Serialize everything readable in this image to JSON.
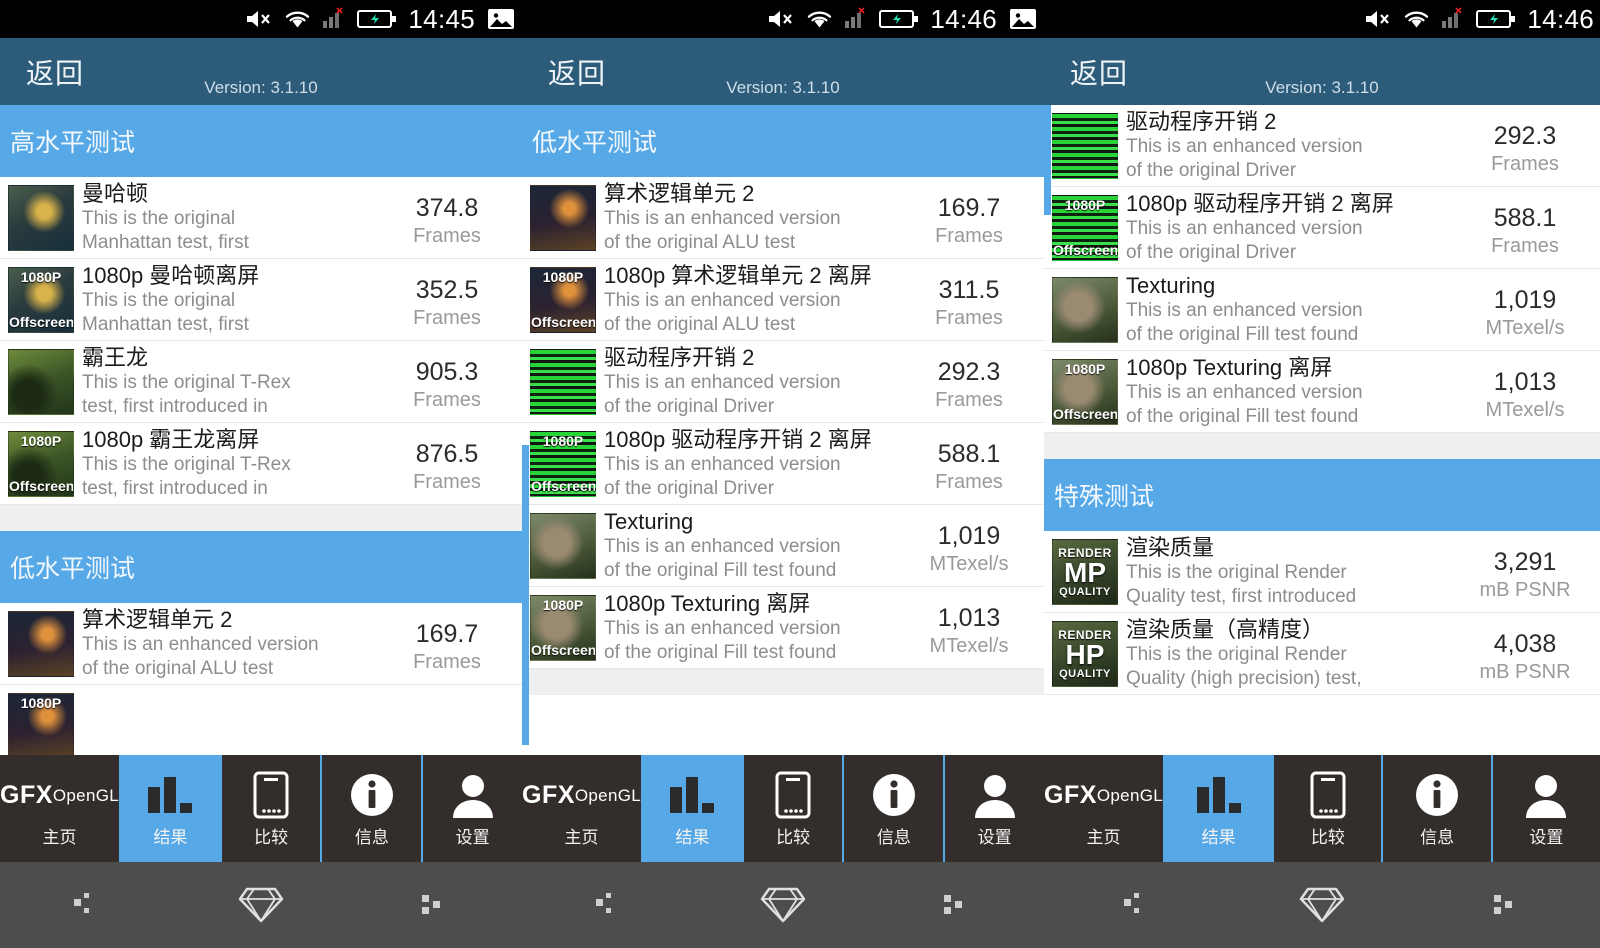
{
  "status_bar": {
    "panels": [
      {
        "time": "14:45",
        "icons": [
          "mute-icon",
          "wifi-icon",
          "signal-icon",
          "battery-charging-icon",
          "screenshot-icon"
        ]
      },
      {
        "time": "14:46",
        "icons": [
          "mute-icon",
          "wifi-icon",
          "signal-icon",
          "battery-charging-icon",
          "screenshot-icon"
        ]
      },
      {
        "time": "14:46",
        "icons": [
          "mute-icon",
          "wifi-icon",
          "signal-icon",
          "battery-charging-icon"
        ]
      }
    ]
  },
  "app_bar": {
    "back_label": "返回",
    "version_label": "Version: 3.1.10"
  },
  "sections": {
    "high_level": "高水平测试",
    "low_level": "低水平测试",
    "special": "特殊测试"
  },
  "units": {
    "frames": "Frames",
    "mtexel": "MTexel/s",
    "psnr": "mB PSNR"
  },
  "descriptions": {
    "manhattan": [
      "This is the original",
      "Manhattan test, first"
    ],
    "trex": [
      "This is the original T-Rex",
      "test, first introduced in"
    ],
    "alu": [
      "This is an enhanced version",
      "of the original ALU test"
    ],
    "driver": [
      "This is an enhanced version",
      "of the original Driver"
    ],
    "fill": [
      "This is an enhanced version",
      "of the original Fill test found"
    ],
    "render_mp": [
      "This is the original Render",
      "Quality test, first introduced"
    ],
    "render_hp": [
      "This is the original Render",
      "Quality (high precision) test,"
    ]
  },
  "panel1": {
    "section_a": "高水平测试",
    "rows_a": [
      {
        "title": "曼哈顿",
        "d1": "This is the original",
        "d2": "Manhattan test, first",
        "num": "374.8",
        "unit": "Frames",
        "thumb": "th-manhattan",
        "badge_top": "",
        "badge_bot": ""
      },
      {
        "title": "1080p 曼哈顿离屏",
        "d1": "This is the original",
        "d2": "Manhattan test, first",
        "num": "352.5",
        "unit": "Frames",
        "thumb": "th-manhattan",
        "badge_top": "1080P",
        "badge_bot": "Offscreen"
      },
      {
        "title": "霸王龙",
        "d1": "This is the original T-Rex",
        "d2": "test, first introduced in",
        "num": "905.3",
        "unit": "Frames",
        "thumb": "th-trex",
        "badge_top": "",
        "badge_bot": ""
      },
      {
        "title": "1080p 霸王龙离屏",
        "d1": "This is the original T-Rex",
        "d2": "test, first introduced in",
        "num": "876.5",
        "unit": "Frames",
        "thumb": "th-trex",
        "badge_top": "1080P",
        "badge_bot": "Offscreen"
      }
    ],
    "section_b": "低水平测试",
    "rows_b": [
      {
        "title": "算术逻辑单元 2",
        "d1": "This is an enhanced version",
        "d2": "of the original ALU test",
        "num": "169.7",
        "unit": "Frames",
        "thumb": "th-alu",
        "badge_top": "",
        "badge_bot": ""
      }
    ]
  },
  "panel2": {
    "section_a": "低水平测试",
    "rows_a": [
      {
        "title": "算术逻辑单元 2",
        "d1": "This is an enhanced version",
        "d2": "of the original ALU test",
        "num": "169.7",
        "unit": "Frames",
        "thumb": "th-alu",
        "badge_top": "",
        "badge_bot": ""
      },
      {
        "title": "1080p 算术逻辑单元 2 离屏",
        "d1": "This is an enhanced version",
        "d2": "of the original ALU test",
        "num": "311.5",
        "unit": "Frames",
        "thumb": "th-alu",
        "badge_top": "1080P",
        "badge_bot": "Offscreen"
      },
      {
        "title": "驱动程序开销 2",
        "d1": "This is an enhanced version",
        "d2": "of the original Driver",
        "num": "292.3",
        "unit": "Frames",
        "thumb": "th-driver",
        "badge_top": "",
        "badge_bot": ""
      },
      {
        "title": "1080p 驱动程序开销 2 离屏",
        "d1": "This is an enhanced version",
        "d2": "of the original Driver",
        "num": "588.1",
        "unit": "Frames",
        "thumb": "th-driver",
        "badge_top": "1080P",
        "badge_bot": "Offscreen"
      },
      {
        "title": "Texturing",
        "d1": "This is an enhanced version",
        "d2": "of the original Fill test found",
        "num": "1,019",
        "unit": "MTexel/s",
        "thumb": "th-tex",
        "badge_top": "",
        "badge_bot": ""
      },
      {
        "title": "1080p Texturing 离屏",
        "d1": "This is an enhanced version",
        "d2": "of the original Fill test found",
        "num": "1,013",
        "unit": "MTexel/s",
        "thumb": "th-tex",
        "badge_top": "1080P",
        "badge_bot": "Offscreen"
      }
    ]
  },
  "panel3": {
    "rows_a": [
      {
        "title": "驱动程序开销 2",
        "d1": "This is an enhanced version",
        "d2": "of the original Driver",
        "num": "292.3",
        "unit": "Frames",
        "thumb": "th-driver",
        "badge_top": "",
        "badge_bot": ""
      },
      {
        "title": "1080p 驱动程序开销 2 离屏",
        "d1": "This is an enhanced version",
        "d2": "of the original Driver",
        "num": "588.1",
        "unit": "Frames",
        "thumb": "th-driver",
        "badge_top": "1080P",
        "badge_bot": "Offscreen"
      },
      {
        "title": "Texturing",
        "d1": "This is an enhanced version",
        "d2": "of the original Fill test found",
        "num": "1,019",
        "unit": "MTexel/s",
        "thumb": "th-tex",
        "badge_top": "",
        "badge_bot": ""
      },
      {
        "title": "1080p Texturing 离屏",
        "d1": "This is an enhanced version",
        "d2": "of the original Fill test found",
        "num": "1,013",
        "unit": "MTexel/s",
        "thumb": "th-tex",
        "badge_top": "1080P",
        "badge_bot": "Offscreen"
      }
    ],
    "section_b": "特殊测试",
    "rows_b": [
      {
        "title": "渲染质量",
        "d1": "This is the original Render",
        "d2": "Quality test, first introduced",
        "num": "3,291",
        "unit": "mB PSNR",
        "thumb": "th-render",
        "rq": [
          "RENDER",
          "MP",
          "QUALITY"
        ]
      },
      {
        "title": "渲染质量（高精度）",
        "d1": "This is the original Render",
        "d2": "Quality (high precision) test,",
        "num": "4,038",
        "unit": "mB PSNR",
        "thumb": "th-render",
        "rq": [
          "RENDER",
          "HP",
          "QUALITY"
        ]
      }
    ]
  },
  "tabs": [
    {
      "label": "主页",
      "icon": "gfx-opengl-icon",
      "active": false,
      "gfx_line1": "GFX",
      "gfx_line2": "OpenGL"
    },
    {
      "label": "结果",
      "icon": "bar-chart-icon",
      "active": true
    },
    {
      "label": "比较",
      "icon": "phone-icon",
      "active": false
    },
    {
      "label": "信息",
      "icon": "info-icon",
      "active": false
    },
    {
      "label": "设置",
      "icon": "person-icon",
      "active": false
    }
  ],
  "system_nav": {
    "buttons": [
      {
        "name": "back-icon"
      },
      {
        "name": "home-diamond-icon"
      },
      {
        "name": "recents-icon"
      }
    ]
  },
  "colors": {
    "app_bar": "#2d5c7b",
    "section_header": "#56a9e6",
    "accent": "#56a9e6",
    "tab_bg": "#332e2b",
    "sys_nav": "#4d4d4d",
    "gap": "#efefef"
  }
}
